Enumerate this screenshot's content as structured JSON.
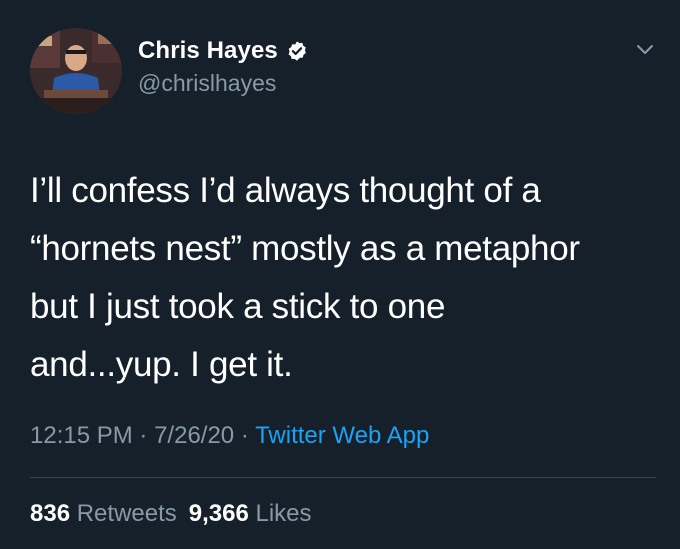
{
  "author": {
    "display_name": "Chris Hayes",
    "handle": "@chrislhayes",
    "verified": true
  },
  "tweet": {
    "lines": [
      "I’ll confess I’d always thought of a",
      "“hornets nest” mostly as a metaphor",
      "but I just took a stick to one",
      "and...yup. I get it."
    ],
    "time": "12:15 PM",
    "date": "7/26/20",
    "separator": "·",
    "source": "Twitter Web App"
  },
  "stats": {
    "retweets_count": "836",
    "retweets_label": "Retweets",
    "likes_count": "9,366",
    "likes_label": "Likes"
  },
  "colors": {
    "background": "#15202b",
    "primary_text": "#ffffff",
    "secondary_text": "#8899a6",
    "link": "#1da1f2",
    "divider": "#38444d"
  },
  "icons": {
    "verified": "verified-badge-icon",
    "menu": "chevron-down-icon"
  }
}
